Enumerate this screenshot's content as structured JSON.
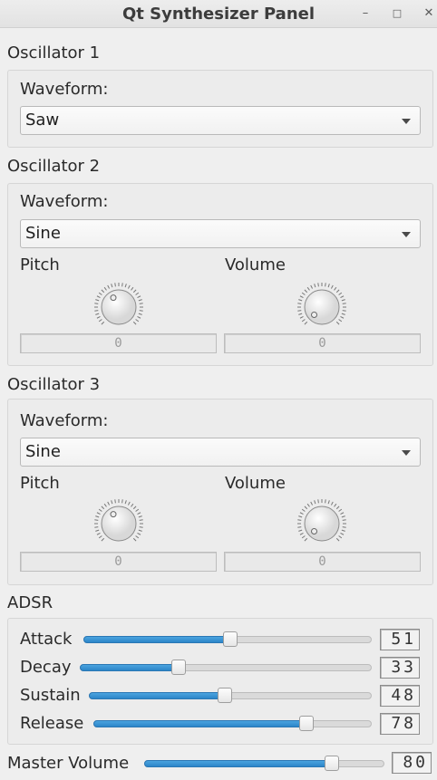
{
  "window": {
    "title": "Qt Synthesizer Panel",
    "minimize": "–",
    "maximize": "□",
    "close": "✕"
  },
  "osc1": {
    "title": "Oscillator 1",
    "waveform_label": "Waveform:",
    "waveform_value": "Saw"
  },
  "osc2": {
    "title": "Oscillator 2",
    "waveform_label": "Waveform:",
    "waveform_value": "Sine",
    "pitch_label": "Pitch",
    "volume_label": "Volume",
    "pitch_display": "0",
    "volume_display": "0"
  },
  "osc3": {
    "title": "Oscillator 3",
    "waveform_label": "Waveform:",
    "waveform_value": "Sine",
    "pitch_label": "Pitch",
    "volume_label": "Volume",
    "pitch_display": "0",
    "volume_display": "0"
  },
  "adsr": {
    "title": "ADSR",
    "attack_label": "Attack",
    "attack_value": "51",
    "decay_label": "Decay",
    "decay_value": "33",
    "sustain_label": "Sustain",
    "sustain_value": "48",
    "release_label": "Release",
    "release_value": "78"
  },
  "master": {
    "label": "Master Volume",
    "value": "80"
  },
  "colors": {
    "slider_fill": "#3595d4",
    "background": "#efefef"
  }
}
